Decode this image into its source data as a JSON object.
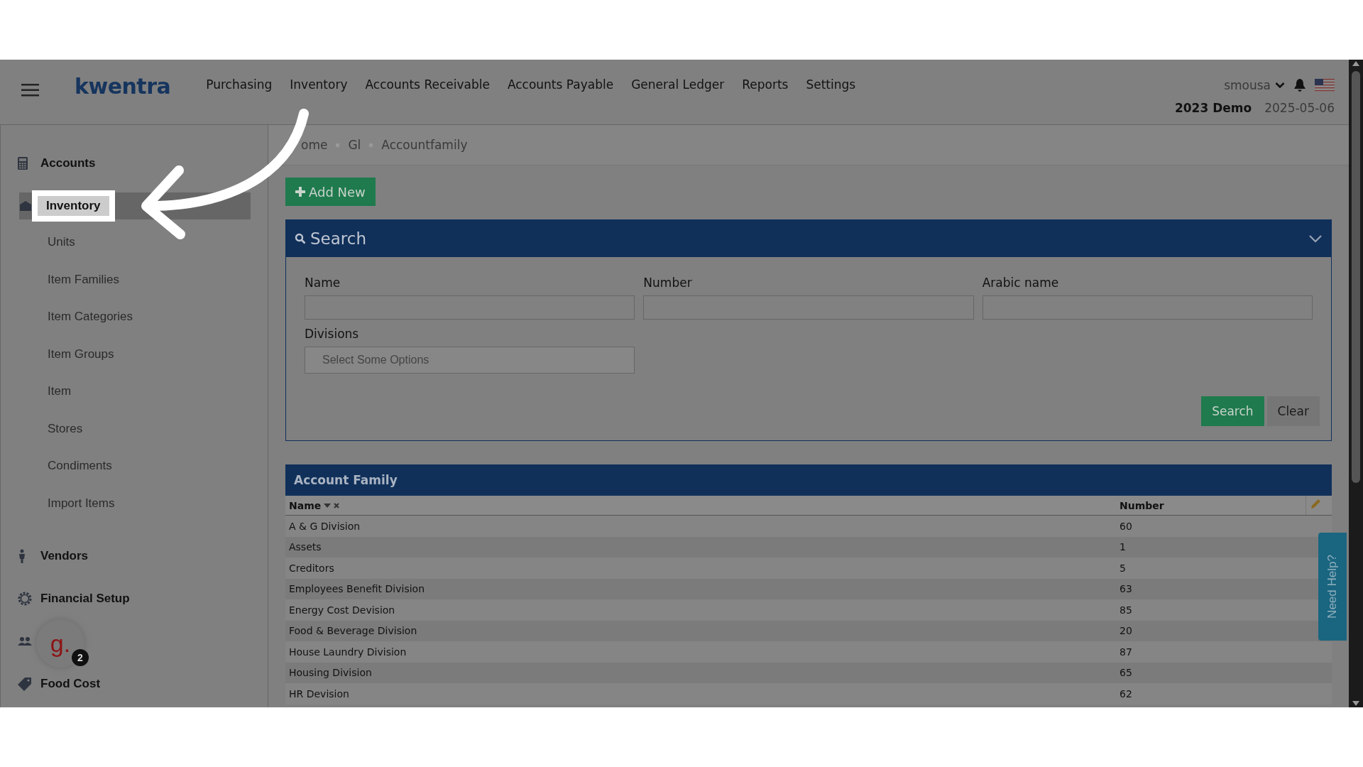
{
  "header": {
    "logo": "kwentra",
    "nav": [
      "Purchasing",
      "Inventory",
      "Accounts Receivable",
      "Accounts Payable",
      "General Ledger",
      "Reports",
      "Settings"
    ],
    "user": "smousa",
    "company": "2023 Demo",
    "date": "2025-05-06"
  },
  "sidebar": {
    "sections": [
      {
        "label": "Accounts",
        "selected": false
      },
      {
        "label": "Inventory",
        "selected": true,
        "children": [
          "Units",
          "Item Families",
          "Item Categories",
          "Item Groups",
          "Item",
          "Stores",
          "Condiments",
          "Import Items"
        ]
      },
      {
        "label": "Vendors",
        "selected": false
      },
      {
        "label": "Financial Setup",
        "selected": false
      },
      {
        "selected": false
      },
      {
        "label": "Food Cost",
        "selected": false
      }
    ]
  },
  "chat_widget": {
    "logo": "g.",
    "badge": "2"
  },
  "breadcrumb": [
    "ome",
    "Gl",
    "Accountfamily"
  ],
  "add_button": "Add New",
  "search_panel": {
    "title": "Search",
    "fields": [
      {
        "label": "Name",
        "kind": "text"
      },
      {
        "label": "Number",
        "kind": "text"
      },
      {
        "label": "Arabic name",
        "kind": "text"
      },
      {
        "label": "Divisions",
        "kind": "select",
        "placeholder": "Select Some Options"
      }
    ],
    "buttons": [
      "Search",
      "Clear"
    ]
  },
  "table": {
    "title": "Account Family",
    "columns": [
      "Name",
      "Number"
    ],
    "rows": [
      [
        "A & G Division",
        "60"
      ],
      [
        "Assets",
        "1"
      ],
      [
        "Creditors",
        "5"
      ],
      [
        "Employees Benefit Division",
        "63"
      ],
      [
        "Energy Cost Devision",
        "85"
      ],
      [
        "Food & Beverage Division",
        "20"
      ],
      [
        "House Laundry Division",
        "87"
      ],
      [
        "Housing Division",
        "65"
      ],
      [
        "HR Devision",
        "62"
      ]
    ]
  },
  "help_tab": "Need Help?"
}
